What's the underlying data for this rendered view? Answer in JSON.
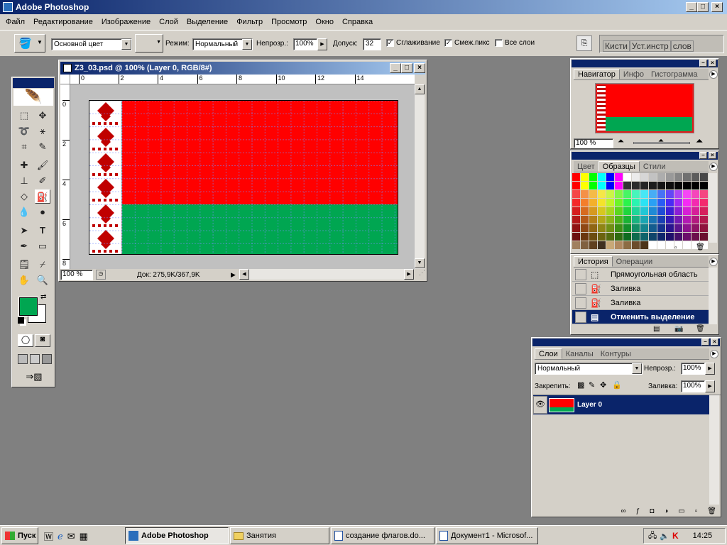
{
  "app": {
    "title": "Adobe Photoshop"
  },
  "menu": [
    "Файл",
    "Редактирование",
    "Изображение",
    "Слой",
    "Выделение",
    "Фильтр",
    "Просмотр",
    "Окно",
    "Справка"
  ],
  "options": {
    "fill_source": "Основной цвет",
    "mode_label": "Режим:",
    "mode_value": "Нормальный",
    "opacity_label": "Непрозр.:",
    "opacity_value": "100%",
    "tolerance_label": "Допуск:",
    "tolerance_value": "32",
    "antialias_label": "Сглаживание",
    "contiguous_label": "Смеж.пикс",
    "all_layers_label": "Все слои",
    "well_tabs": [
      "Кисти",
      "Уст.инстр",
      "слов"
    ]
  },
  "document": {
    "title": "Z3_03.psd @ 100% (Layer 0, RGB/8#)",
    "zoom": "100 %",
    "doc_info": "Док: 275,9K/367,9K",
    "ruler_h": [
      "0",
      "2",
      "4",
      "6",
      "8",
      "10",
      "12",
      "14"
    ],
    "ruler_v": [
      "0",
      "2",
      "4",
      "6",
      "8"
    ]
  },
  "flag_colors": {
    "red": "#ff0000",
    "green": "#00a651",
    "ornament": "#c00000"
  },
  "navigator": {
    "tabs": [
      "Навигатор",
      "Инфо",
      "Гистограмма"
    ],
    "zoom": "100 %"
  },
  "swatches_panel": {
    "tabs": [
      "Цвет",
      "Образцы",
      "Стили"
    ]
  },
  "history": {
    "tabs": [
      "История",
      "Операции"
    ],
    "items": [
      {
        "label": "Прямоугольная область",
        "icon": "marquee-icon"
      },
      {
        "label": "Заливка",
        "icon": "bucket-icon"
      },
      {
        "label": "Заливка",
        "icon": "bucket-icon"
      },
      {
        "label": "Отменить выделение",
        "icon": "document-icon",
        "selected": true
      }
    ]
  },
  "layers": {
    "tabs": [
      "Слои",
      "Каналы",
      "Контуры"
    ],
    "blend_mode": "Нормальный",
    "opacity_label": "Непрозр.:",
    "opacity_value": "100%",
    "lock_label": "Закрепить:",
    "fill_label": "Заливка:",
    "fill_value": "100%",
    "layer_name": "Layer 0"
  },
  "colors": {
    "foreground": "#00a651",
    "background": "#ffffff"
  },
  "taskbar": {
    "start": "Пуск",
    "tasks": [
      "Adobe Photoshop",
      "Занятия",
      "создание флагов.do...",
      "Документ1 - Microsof..."
    ],
    "clock": "14:25"
  }
}
